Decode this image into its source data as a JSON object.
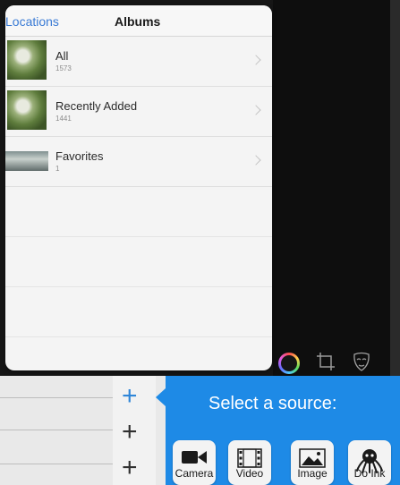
{
  "popover": {
    "back_label": "Locations",
    "title": "Albums",
    "albums": [
      {
        "name": "All",
        "count": "1573"
      },
      {
        "name": "Recently Added",
        "count": "1441"
      },
      {
        "name": "Favorites",
        "count": "1"
      }
    ]
  },
  "source": {
    "title": "Select a source:",
    "buttons": [
      {
        "label": "Camera",
        "icon": "camera-icon"
      },
      {
        "label": "Video",
        "icon": "film-icon"
      },
      {
        "label": "Image",
        "icon": "image-icon"
      },
      {
        "label": "Do Ink",
        "icon": "octopus-icon"
      }
    ]
  },
  "plus_buttons": [
    "+",
    "+",
    "+"
  ],
  "colors": {
    "accent_blue": "#1e8ae6",
    "link_blue": "#3a7bd5"
  }
}
